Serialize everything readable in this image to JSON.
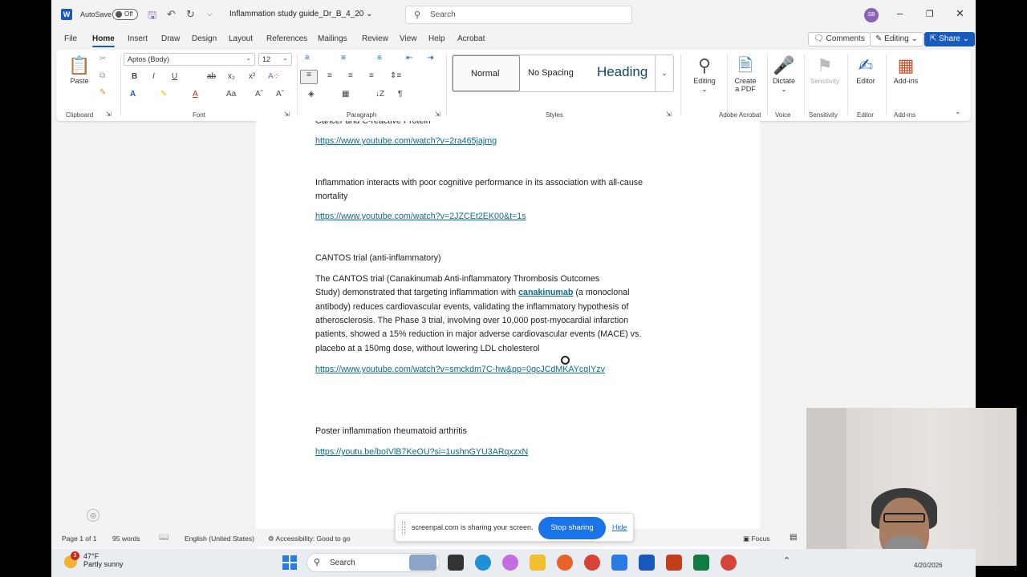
{
  "titlebar": {
    "autosave_label": "AutoSave",
    "autosave_state": "Off",
    "doc_title": "Inflammation study guide_Dr_B_4_20",
    "search_placeholder": "Search",
    "avatar_initials": "SB"
  },
  "menu": {
    "tabs": [
      "File",
      "Home",
      "Insert",
      "Draw",
      "Design",
      "Layout",
      "References",
      "Mailings",
      "Review",
      "View",
      "Help",
      "Acrobat"
    ],
    "active": "Home",
    "comments_label": "Comments",
    "editing_label": "Editing",
    "share_label": "Share"
  },
  "ribbon": {
    "clipboard": {
      "paste_label": "Paste",
      "group_label": "Clipboard"
    },
    "font": {
      "name": "Aptos (Body)",
      "size": "12",
      "group_label": "Font"
    },
    "paragraph": {
      "group_label": "Paragraph"
    },
    "styles": {
      "items": [
        "Normal",
        "No Spacing",
        "Heading"
      ],
      "selected": "Normal",
      "group_label": "Styles"
    },
    "editing": {
      "label": "Editing"
    },
    "acrobat": {
      "label_line1": "Create",
      "label_line2": "a PDF",
      "group_label": "Adobe Acrobat"
    },
    "voice": {
      "label": "Dictate",
      "group_label": "Voice"
    },
    "sensitivity": {
      "label": "Sensitivity",
      "group_label": "Sensitivity"
    },
    "editor": {
      "label": "Editor",
      "group_label": "Editor"
    },
    "addins": {
      "label": "Add-ins",
      "group_label": "Add-ins"
    }
  },
  "document": {
    "partial_heading": "Cancer and C-reactive Protein",
    "link1": "https://www.youtube.com/watch?v=2ra465jajmg",
    "para2_line1": "Inflammation interacts with poor cognitive performance in its association with all-cause",
    "para2_line2": "mortality",
    "link2": "https://www.youtube.com/watch?v=2JZCEt2EK00&t=1s",
    "heading3": "CANTOS trial (anti-inflammatory)",
    "para3_line1": "The CANTOS trial (Canakinumab Anti-inflammatory Thrombosis Outcomes",
    "para3_line2_a": "Study) demonstrated that targeting inflammation with ",
    "para3_line2_link": "canakinumab",
    "para3_line2_b": " (a monoclonal",
    "para3_line3": "antibody) reduces cardiovascular events, validating the inflammatory hypothesis of",
    "para3_line4": "atherosclerosis. The Phase 3 trial, involving over 10,000 post-myocardial infarction",
    "para3_line5": "patients, showed a 15% reduction in major adverse cardiovascular events (MACE) vs.",
    "para3_line6": "placebo at a 150mg dose, without lowering LDL cholesterol",
    "link3": "https://www.youtube.com/watch?v=smckdm7C-hw&pp=0gcJCdMKAYcqIYzv",
    "heading4": "Poster inflammation rheumatoid arthritis",
    "link4": "https://youtu.be/boIVlB7KeOU?si=1ushnGYU3ARqxzxN"
  },
  "statusbar": {
    "page": "Page 1 of 1",
    "words": "95 words",
    "language": "English (United States)",
    "accessibility": "Accessibility: Good to go",
    "focus": "Focus"
  },
  "screenpal": {
    "message": "screenpal.com is sharing your screen.",
    "stop_label": "Stop sharing",
    "hide_label": "Hide"
  },
  "taskbar": {
    "temperature": "47°F",
    "weather": "Partly sunny",
    "notification_count": "3",
    "search_label": "Search",
    "date": "4/20/2026"
  }
}
